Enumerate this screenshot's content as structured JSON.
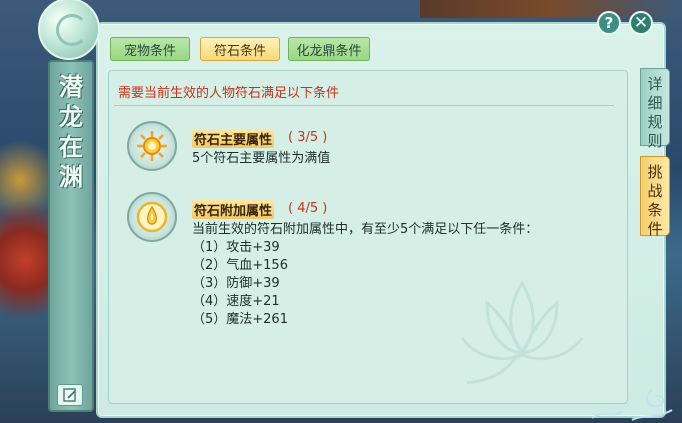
{
  "banner": {
    "title": "潜龙在渊"
  },
  "tabs": [
    {
      "label": "宠物条件",
      "active": false
    },
    {
      "label": "符石条件",
      "active": true
    },
    {
      "label": "化龙鼎条件",
      "active": false
    }
  ],
  "side_tabs": [
    {
      "label": "详细规则",
      "active": false
    },
    {
      "label": "挑战条件",
      "active": true
    }
  ],
  "requirement_title": "需要当前生效的人物符石满足以下条件",
  "conditions": [
    {
      "title": "符石主要属性",
      "count": "( 3/5 )",
      "icon": "sun-rune-icon",
      "lines": [
        "5个符石主要属性为满值"
      ]
    },
    {
      "title": "符石附加属性",
      "count": "( 4/5 )",
      "icon": "flame-rune-icon",
      "lines": [
        "当前生效的符石附加属性中，有至少5个满足以下任一条件：",
        "（1）攻击+39",
        "（2）气血+156",
        "（3）防御+39",
        "（4）速度+21",
        "（5）魔法+261"
      ]
    }
  ],
  "buttons": {
    "help": "?",
    "close": "✕"
  },
  "colors": {
    "panel_bg": "#d9f2ea",
    "accent_red": "#c8321c",
    "tab_active": "#f7d97a",
    "tab_green": "#9ad685"
  }
}
